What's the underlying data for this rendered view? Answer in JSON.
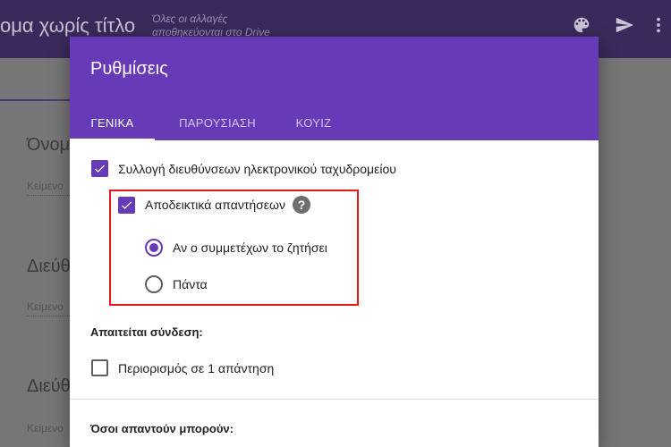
{
  "app": {
    "doc_title": "ομα χωρίς τίτλο",
    "save_status": "Όλες οι αλλαγές αποθηκεύονται στο Drive",
    "icons": [
      "palette-icon",
      "send-icon",
      "more-vert-icon"
    ]
  },
  "background": {
    "field_labels": [
      "Όνομ",
      "Διεύθ",
      "Διεύθ"
    ],
    "field_hints": [
      "Κείμενο",
      "Κείμενο",
      "Κείμενο"
    ]
  },
  "dialog": {
    "title": "Ρυθμίσεις",
    "tabs": [
      {
        "label": "ΓΕΝΙΚΑ",
        "active": true
      },
      {
        "label": "ΠΑΡΟΥΣΙΑΣΗ",
        "active": false
      },
      {
        "label": "ΚΟΥΙΖ",
        "active": false
      }
    ],
    "collect_emails": {
      "label": "Συλλογή διευθύνσεων ηλεκτρονικού ταχυδρομείου",
      "checked": true
    },
    "response_receipts": {
      "label": "Αποδεικτικά απαντήσεων",
      "checked": true,
      "help": "?",
      "options": [
        {
          "label": "Αν ο συμμετέχων το ζητήσει",
          "selected": true
        },
        {
          "label": "Πάντα",
          "selected": false
        }
      ]
    },
    "requires_signin": {
      "title": "Απαιτείται σύνδεση:"
    },
    "limit_one": {
      "label": "Περιορισμός σε 1 απάντηση",
      "checked": false
    },
    "respondents_can": {
      "title": "Όσοι απαντούν μπορούν:"
    }
  },
  "colors": {
    "accent": "#673ab7",
    "highlight": "#e8151b"
  }
}
